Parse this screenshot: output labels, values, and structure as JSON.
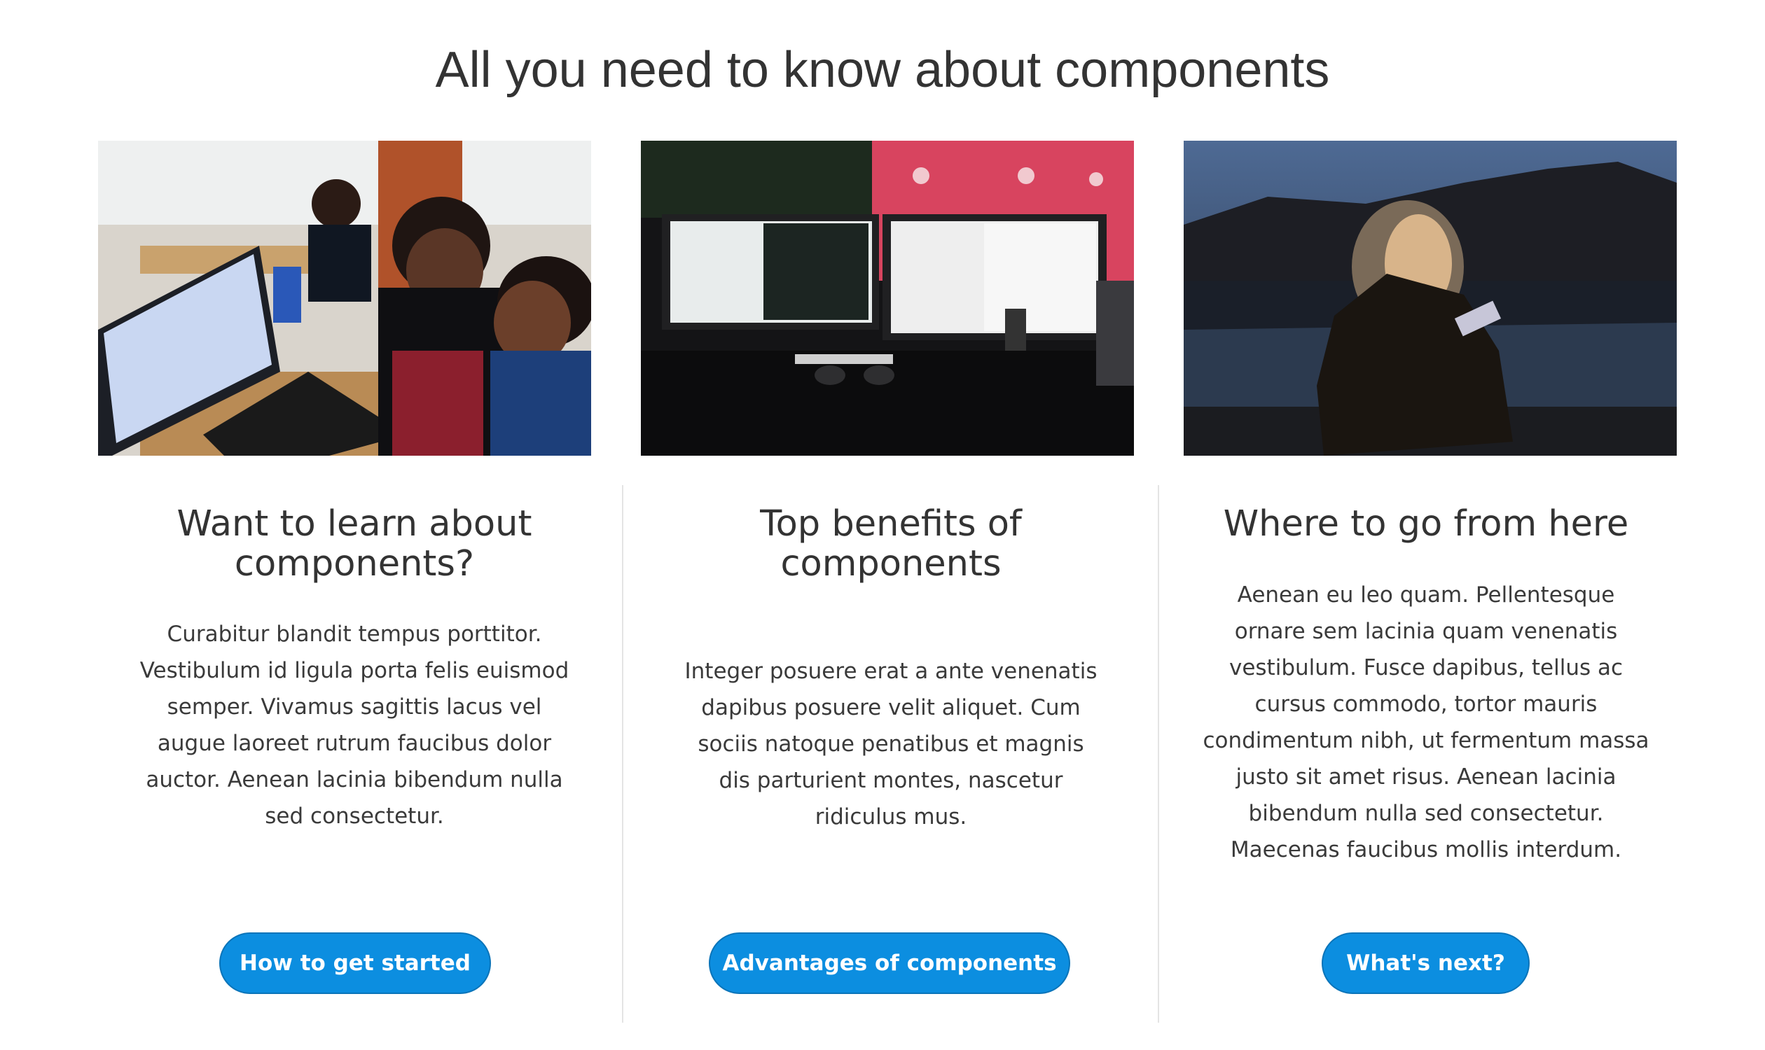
{
  "page": {
    "title": "All you need to know about components"
  },
  "colors": {
    "accent": "#0c8ee0",
    "text": "#333333",
    "divider": "#e4e4e4"
  },
  "cards": [
    {
      "image_icon": "office-team-photo",
      "title": "Want to learn about components?",
      "text": "Curabitur blandit tempus porttitor. Vestibulum id ligula porta felis euismod semper. Vivamus sagittis lacus vel augue laoreet rutrum faucibus dolor auctor. Aenean lacinia bibendum nulla sed consectetur.",
      "button_label": "How to get started"
    },
    {
      "image_icon": "monitors-desk-photo",
      "title": "Top benefits of components",
      "text": "Integer posuere erat a ante venenatis dapibus posuere velit aliquet. Cum sociis natoque penatibus et magnis dis parturient montes, nascetur ridiculus mus.",
      "button_label": "Advantages of components"
    },
    {
      "image_icon": "woman-phone-lake-photo",
      "title": "Where to go from here",
      "text": "Aenean eu leo quam. Pellentesque ornare sem lacinia quam venenatis vestibulum. Fusce dapibus, tellus ac cursus commodo, tortor mauris condimentum nibh, ut fermentum massa justo sit amet risus. Aenean lacinia bibendum nulla sed consectetur. Maecenas faucibus mollis interdum.",
      "button_label": "What's next?"
    }
  ]
}
